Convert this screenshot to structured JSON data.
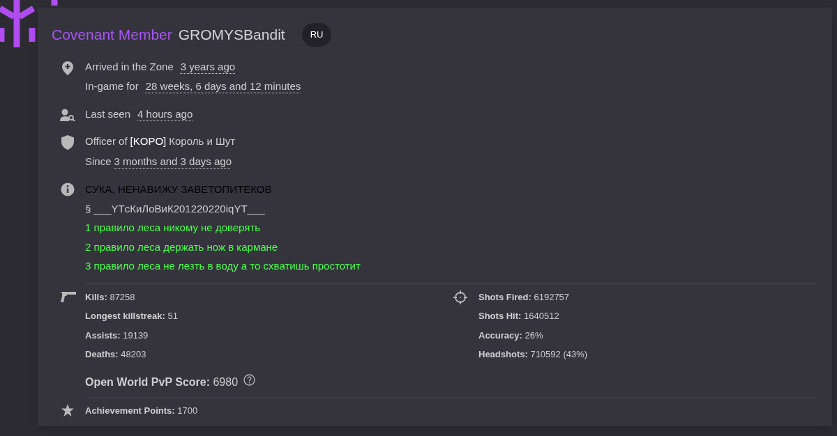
{
  "header": {
    "rank": "Covenant Member",
    "name": "GROMYSBandit",
    "region": "RU"
  },
  "arrived": {
    "label": "Arrived in the Zone",
    "value": "3 years ago"
  },
  "ingame": {
    "label": "In-game for",
    "value": "28 weeks, 6 days and 12 minutes"
  },
  "last_seen": {
    "label": "Last seen",
    "value": "4 hours ago"
  },
  "clan": {
    "prefix": "Officer of",
    "tag": "[KOPO]",
    "name": "Король и Шут",
    "since_label": "Since",
    "since_value": "3 months and 3 days ago"
  },
  "bio": [
    {
      "text": "СУКА, НЕНАВИЖУ ЗАВЕТОПИТЕКОВ",
      "color": "#000000"
    },
    {
      "text": "§ ___YTсКиЛоВиК201220220iqYT___",
      "color": "#cfcfcf"
    },
    {
      "text": "1 правило леса никому не доверять",
      "color": "#4cff4c"
    },
    {
      "text": "2 правило леса держать нож в кармане",
      "color": "#4cff4c"
    },
    {
      "text": "3 правило леса не лезть в воду а то схватишь простотит",
      "color": "#4cff4c"
    }
  ],
  "combat_stats": [
    "**Kills:** 87258",
    "**Longest killstreak:** 51",
    "**Assists:** 19139",
    "**Deaths:** 48203"
  ],
  "shooting_stats": [
    "**Shots Fired:** 6192757",
    "**Shots Hit:** 1640512",
    "**Accuracy:** 26%",
    "**Headshots:** 710592 (43%)"
  ],
  "pvp_score": "**Open World PvP Score:** 6980",
  "achievements": "**Achievement Points:** 1700"
}
